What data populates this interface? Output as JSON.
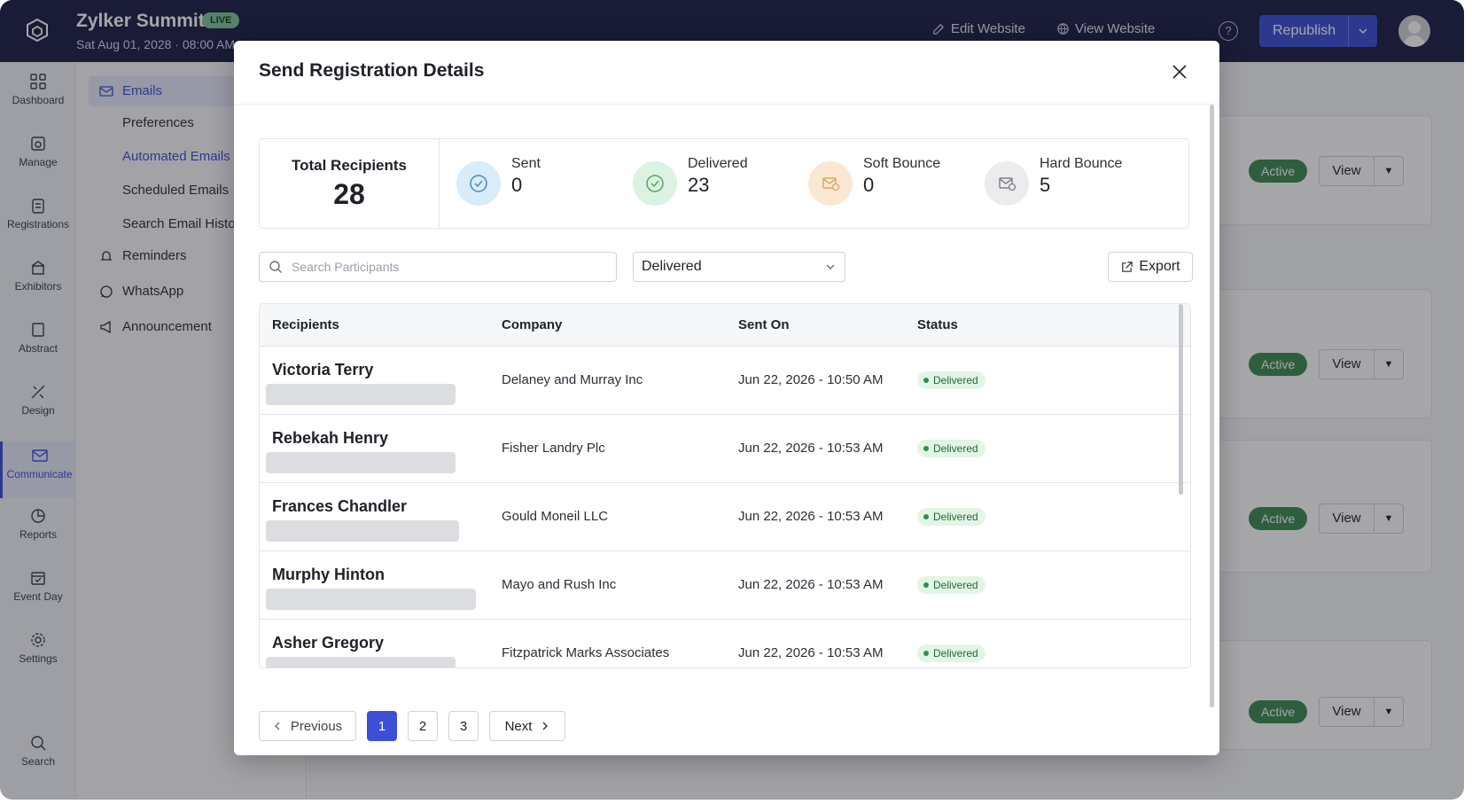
{
  "app": {
    "event_name": "Zylker Summit",
    "live_badge": "LIVE",
    "event_date": "Sat Aug 01, 2028 · 08:00 AM",
    "edit_website": "Edit Website",
    "view_website": "View Website",
    "republish": "Republish"
  },
  "rail": [
    {
      "label": "Dashboard",
      "icon": "dashboard-icon"
    },
    {
      "label": "Manage",
      "icon": "manage-icon"
    },
    {
      "label": "Registrations",
      "icon": "registrations-icon"
    },
    {
      "label": "Exhibitors",
      "icon": "exhibitors-icon"
    },
    {
      "label": "Abstract",
      "icon": "abstract-icon"
    },
    {
      "label": "Design",
      "icon": "design-icon"
    },
    {
      "label": "Communicate",
      "icon": "communicate-icon"
    },
    {
      "label": "Reports",
      "icon": "reports-icon"
    },
    {
      "label": "Event Day",
      "icon": "event-day-icon"
    },
    {
      "label": "Settings",
      "icon": "settings-icon"
    },
    {
      "label": "Search",
      "icon": "search-icon"
    }
  ],
  "subnav": {
    "emails": "Emails",
    "preferences": "Preferences",
    "automated_emails": "Automated Emails",
    "scheduled_emails": "Scheduled Emails",
    "search_email_history": "Search Email History",
    "reminders": "Reminders",
    "whatsapp": "WhatsApp",
    "announcement": "Announcement"
  },
  "background_rows": [
    {
      "status": "Active",
      "view": "View"
    },
    {
      "status": "Active",
      "view": "View"
    },
    {
      "status": "Active",
      "view": "View"
    },
    {
      "status": "Active",
      "view": "View"
    }
  ],
  "modal": {
    "title": "Send Registration Details",
    "total_label": "Total Recipients",
    "total_value": "28",
    "stats": [
      {
        "label": "Sent",
        "value": "0",
        "color": "#d8ecfa",
        "icon": "check-circle-icon"
      },
      {
        "label": "Delivered",
        "value": "23",
        "color": "#dcf2e3",
        "icon": "check-circle-icon"
      },
      {
        "label": "Soft Bounce",
        "value": "0",
        "color": "#fbe8d2",
        "icon": "mail-bounce-icon"
      },
      {
        "label": "Hard Bounce",
        "value": "5",
        "color": "#ececee",
        "icon": "mail-bounce-icon"
      }
    ],
    "search_placeholder": "Search Participants",
    "filter_value": "Delivered",
    "export_label": "Export",
    "columns": {
      "recipients": "Recipients",
      "company": "Company",
      "sent_on": "Sent On",
      "status": "Status"
    },
    "rows": [
      {
        "name": "Victoria Terry",
        "company": "Delaney and Murray Inc",
        "sent_on": "Jun 22, 2026 - 10:50 AM",
        "status": "Delivered"
      },
      {
        "name": "Rebekah Henry",
        "company": "Fisher Landry Plc",
        "sent_on": "Jun 22, 2026 - 10:53 AM",
        "status": "Delivered"
      },
      {
        "name": "Frances Chandler",
        "company": "Gould Moneil LLC",
        "sent_on": "Jun 22, 2026 - 10:53 AM",
        "status": "Delivered"
      },
      {
        "name": "Murphy Hinton",
        "company": "Mayo and Rush Inc",
        "sent_on": "Jun 22, 2026 - 10:53 AM",
        "status": "Delivered"
      },
      {
        "name": "Asher Gregory",
        "company": "Fitzpatrick Marks Associates",
        "sent_on": "Jun 22, 2026 - 10:53 AM",
        "status": "Delivered"
      }
    ],
    "pagination": {
      "previous": "Previous",
      "pages": [
        "1",
        "2",
        "3"
      ],
      "current": "1",
      "next": "Next"
    }
  }
}
